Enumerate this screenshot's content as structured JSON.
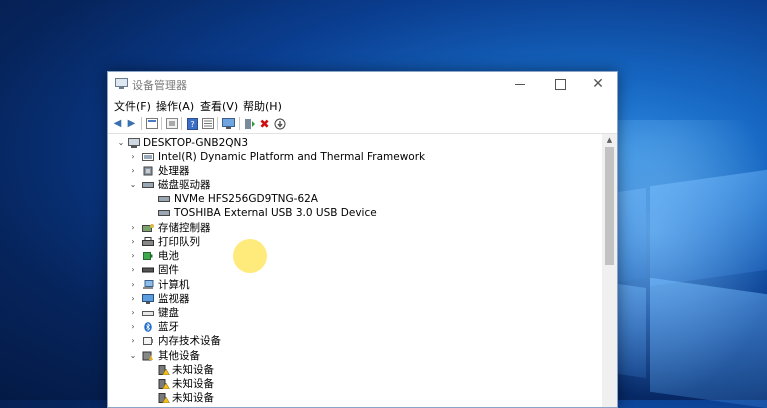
{
  "window": {
    "title": "设备管理器",
    "caption_buttons": [
      "minimize",
      "maximize",
      "close"
    ]
  },
  "menu": [
    {
      "label": "文件(F)"
    },
    {
      "label": "操作(A)"
    },
    {
      "label": "查看(V)"
    },
    {
      "label": "帮助(H)"
    }
  ],
  "toolbar": {
    "icons": [
      "back-icon",
      "forward-icon",
      "properties-icon",
      "show-hidden-icon",
      "help-icon",
      "details-icon",
      "monitor-icon",
      "update-driver-icon",
      "uninstall-icon",
      "scan-hardware-icon"
    ]
  },
  "tree": {
    "root": "DESKTOP-GNB2QN3",
    "items": [
      {
        "label": "Intel(R) Dynamic Platform and Thermal Framework",
        "level": 1,
        "expanded": false
      },
      {
        "label": "处理器",
        "level": 1,
        "expanded": false
      },
      {
        "label": "磁盘驱动器",
        "level": 1,
        "expanded": true
      },
      {
        "label": "NVMe HFS256GD9TNG-62A",
        "level": 2
      },
      {
        "label": "TOSHIBA External USB 3.0 USB Device",
        "level": 2
      },
      {
        "label": "存储控制器",
        "level": 1,
        "expanded": false
      },
      {
        "label": "打印队列",
        "level": 1,
        "expanded": false
      },
      {
        "label": "电池",
        "level": 1,
        "expanded": false
      },
      {
        "label": "固件",
        "level": 1,
        "expanded": false
      },
      {
        "label": "计算机",
        "level": 1,
        "expanded": false
      },
      {
        "label": "监视器",
        "level": 1,
        "expanded": false
      },
      {
        "label": "键盘",
        "level": 1,
        "expanded": false
      },
      {
        "label": "蓝牙",
        "level": 1,
        "expanded": false
      },
      {
        "label": "内存技术设备",
        "level": 1,
        "expanded": false
      },
      {
        "label": "其他设备",
        "level": 1,
        "expanded": true
      },
      {
        "label": "未知设备",
        "level": 2
      },
      {
        "label": "未知设备",
        "level": 2
      },
      {
        "label": "未知设备",
        "level": 2
      }
    ]
  },
  "colors": {
    "desktop": "#0a3d8f",
    "window_bg": "#ffffff",
    "title_text": "#7a7a7a"
  }
}
